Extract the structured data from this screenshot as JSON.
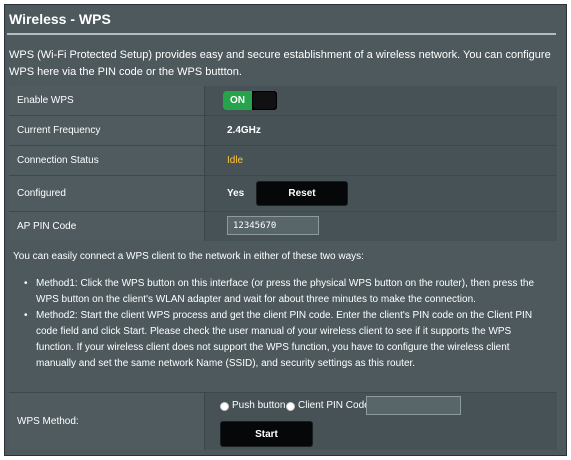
{
  "page": {
    "title": "Wireless - WPS",
    "description": "WPS (Wi-Fi Protected Setup) provides easy and secure establishment of a wireless network. You can configure WPS here via the PIN code or the WPS buttton."
  },
  "settings": {
    "enable_wps": {
      "label": "Enable WPS",
      "toggle_text": "ON"
    },
    "frequency": {
      "label": "Current Frequency",
      "value": "2.4GHz"
    },
    "status": {
      "label": "Connection Status",
      "value": "Idle"
    },
    "configured": {
      "label": "Configured",
      "value": "Yes",
      "reset_label": "Reset"
    },
    "ap_pin": {
      "label": "AP PIN Code",
      "value": "12345670"
    }
  },
  "instructions": {
    "intro": "You can easily connect a WPS client to the network in either of these two ways:",
    "methods": [
      "Method1: Click the WPS button on this interface (or press the physical WPS button on the router), then press the WPS button on the client's WLAN adapter and wait for about three minutes to make the connection.",
      "Method2: Start the client WPS process and get the client PIN code. Enter the client's PIN code on the Client PIN code field and click Start. Please check the user manual of your wireless client to see if it supports the WPS function. If your wireless client does not support the WPS function, you have to configure the wireless client manually and set the same network Name (SSID), and security settings as this router."
    ]
  },
  "wps_method": {
    "label": "WPS Method:",
    "options": [
      "Push button",
      "Client PIN Code"
    ],
    "client_pin_value": "",
    "start_label": "Start"
  },
  "colors": {
    "panel": "#4d595d",
    "toggle_on": "#26a34b",
    "status_idle": "#fec23a"
  }
}
